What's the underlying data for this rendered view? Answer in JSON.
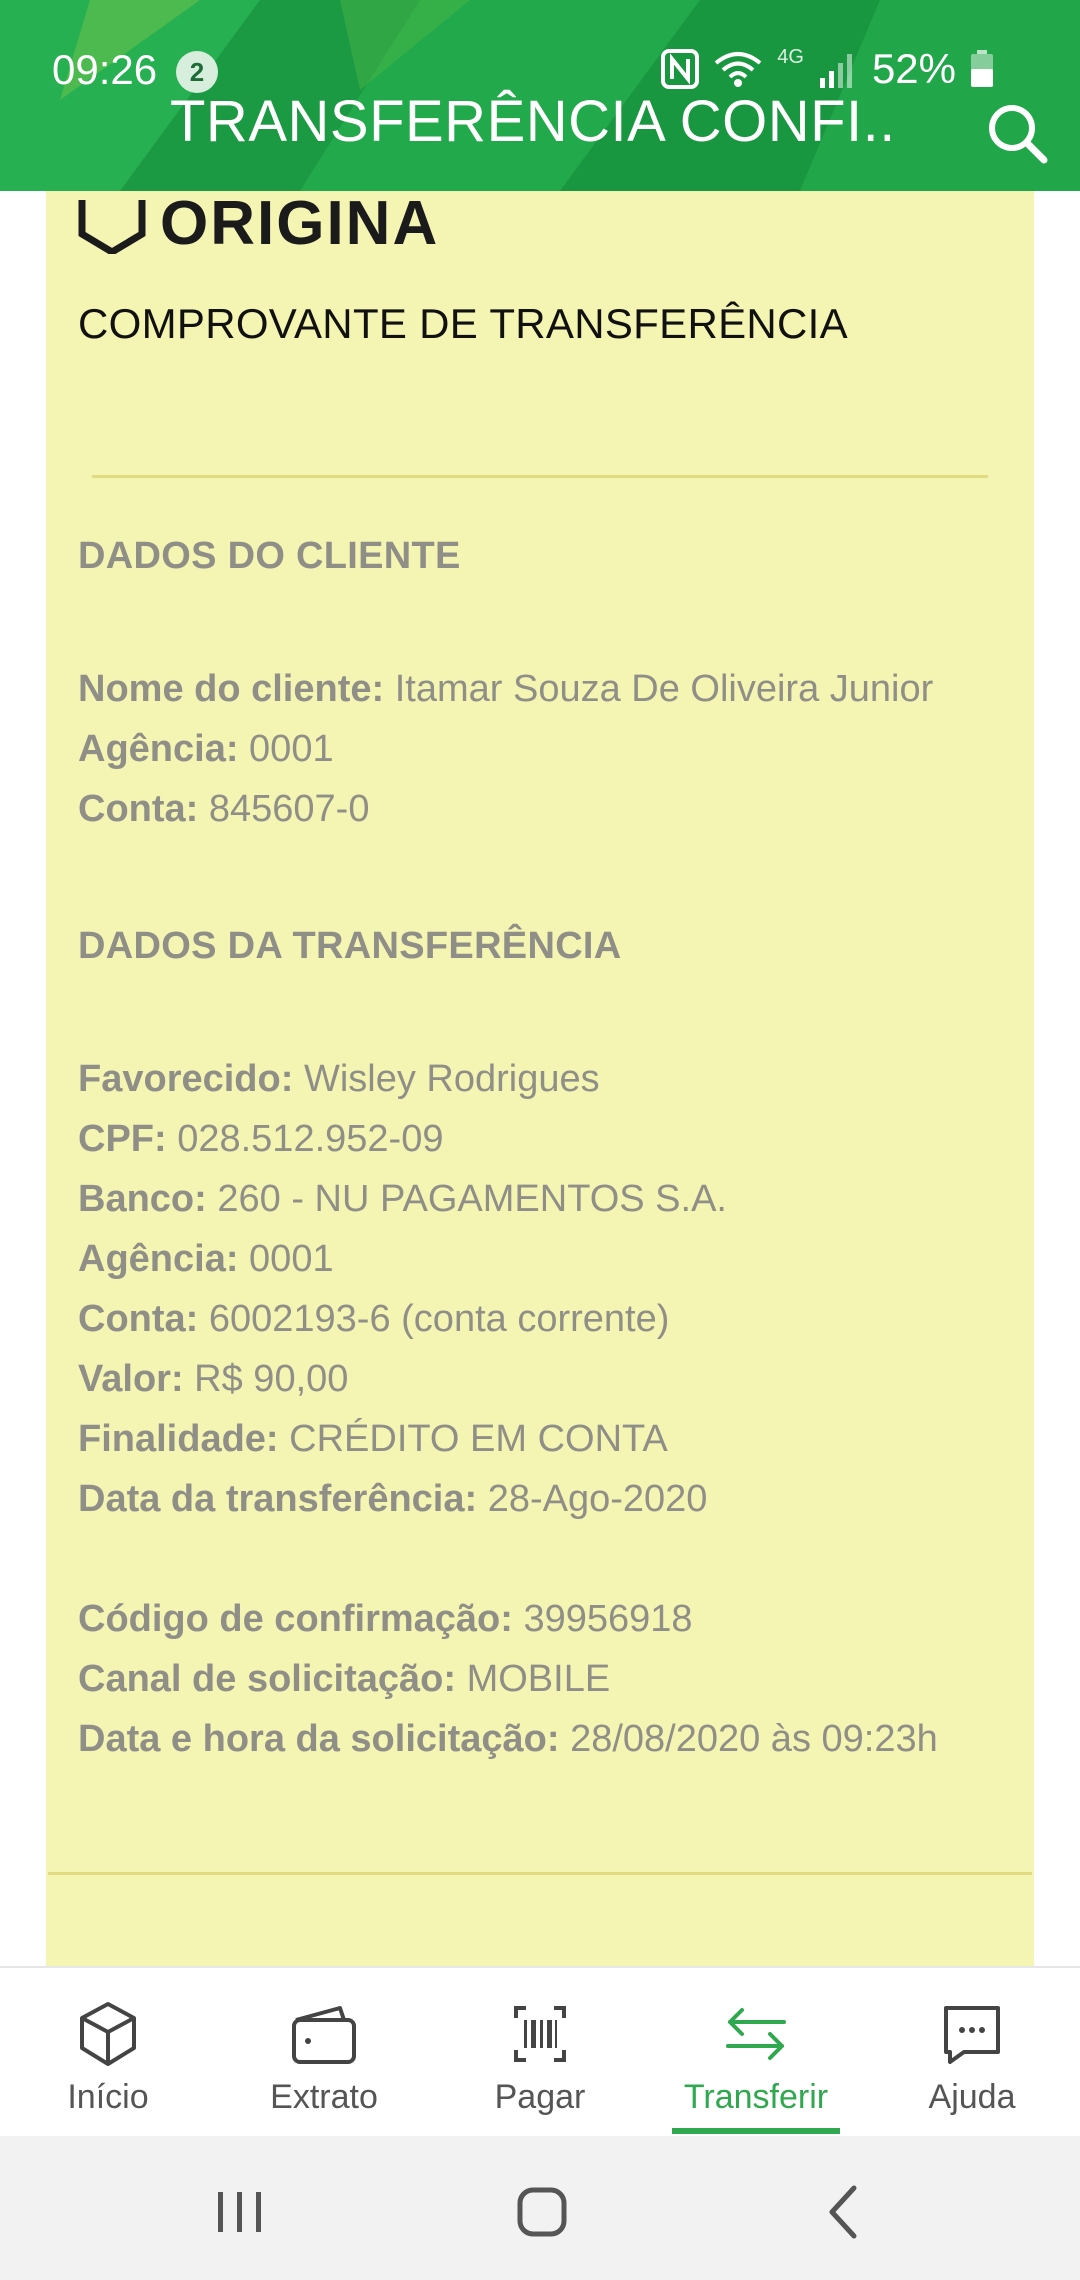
{
  "status_bar": {
    "time": "09:26",
    "notification_count": "2",
    "network": "4G",
    "battery": "52%"
  },
  "header": {
    "title": "TRANSFERÊNCIA CONFI...",
    "search_icon": "search-icon",
    "background_color": "#1ea548"
  },
  "receipt": {
    "logo_text": "ORIGINAL",
    "title": "COMPROVANTE DE TRANSFERÊNCIA",
    "background_color": "#f4f4b3",
    "client_section": {
      "heading": "DADOS DO CLIENTE",
      "name_label": "Nome do cliente:",
      "name_value": "Itamar Souza De Oliveira Junior",
      "agency_label": "Agência:",
      "agency_value": "0001",
      "account_label": "Conta:",
      "account_value": "845607-0"
    },
    "transfer_section": {
      "heading": "DADOS DA TRANSFERÊNCIA",
      "payee_label": "Favorecido:",
      "payee_value": "Wisley Rodrigues",
      "cpf_label": "CPF:",
      "cpf_value": "028.512.952-09",
      "bank_label": "Banco:",
      "bank_value": "260 - NU PAGAMENTOS S.A.",
      "agency_label": "Agência:",
      "agency_value": "0001",
      "account_label": "Conta:",
      "account_value": "6002193-6 (conta corrente)",
      "amount_label": "Valor:",
      "amount_value": "R$ 90,00",
      "purpose_label": "Finalidade:",
      "purpose_value": "CRÉDITO EM CONTA",
      "date_label": "Data da transferência:",
      "date_value": "28-Ago-2020"
    },
    "confirmation": {
      "code_label": "Código de confirmação:",
      "code_value": "39956918",
      "channel_label": "Canal de solicitação:",
      "channel_value": "MOBILE",
      "datetime_label": "Data e hora da solicitação:",
      "datetime_value": "28/08/2020 às 09:23h"
    }
  },
  "bottom_nav": {
    "active_color": "#2fa84f",
    "items": [
      {
        "label": "Início",
        "icon": "cube-icon"
      },
      {
        "label": "Extrato",
        "icon": "wallet-icon"
      },
      {
        "label": "Pagar",
        "icon": "barcode-icon"
      },
      {
        "label": "Transferir",
        "icon": "transfer-arrows-icon",
        "active": true
      },
      {
        "label": "Ajuda",
        "icon": "chat-icon"
      }
    ]
  },
  "system_nav": {
    "recents_icon": "recents-icon",
    "home_icon": "home-icon",
    "back_icon": "back-icon"
  }
}
